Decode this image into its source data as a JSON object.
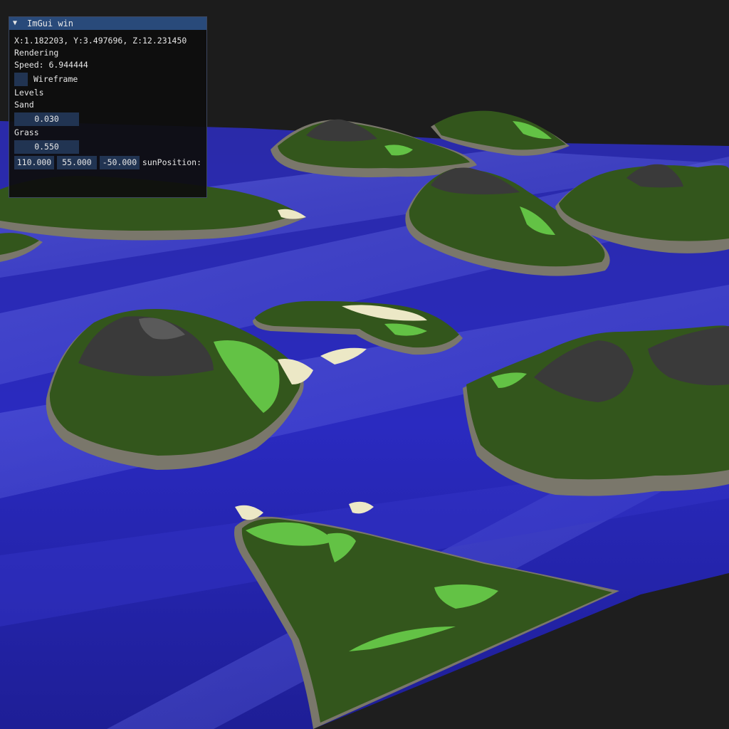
{
  "window": {
    "title": "ImGui win",
    "collapse_icon": "triangle-down-icon"
  },
  "readout": {
    "position_text": "X:1.182203, Y:3.497696, Z:12.231450",
    "section_rendering": "Rendering",
    "speed_text": "Speed: 6.944444"
  },
  "wireframe": {
    "label": "Wireframe",
    "checked": false
  },
  "levels": {
    "heading": "Levels",
    "sand_label": "Sand",
    "sand_value": "0.030",
    "grass_label": "Grass",
    "grass_value": "0.550"
  },
  "sun": {
    "x": "110.000",
    "y": "55.000",
    "z": "-50.000",
    "label": "sunPosition:"
  },
  "colors": {
    "water": "#2626b8",
    "grass_dark": "#33561c",
    "grass_light": "#63c245",
    "rock": "#3a3a3a",
    "sand": "#ece8c6",
    "cliff": "#7a776b",
    "title_bar": "#294a7a",
    "widget_bg": "#213452"
  }
}
